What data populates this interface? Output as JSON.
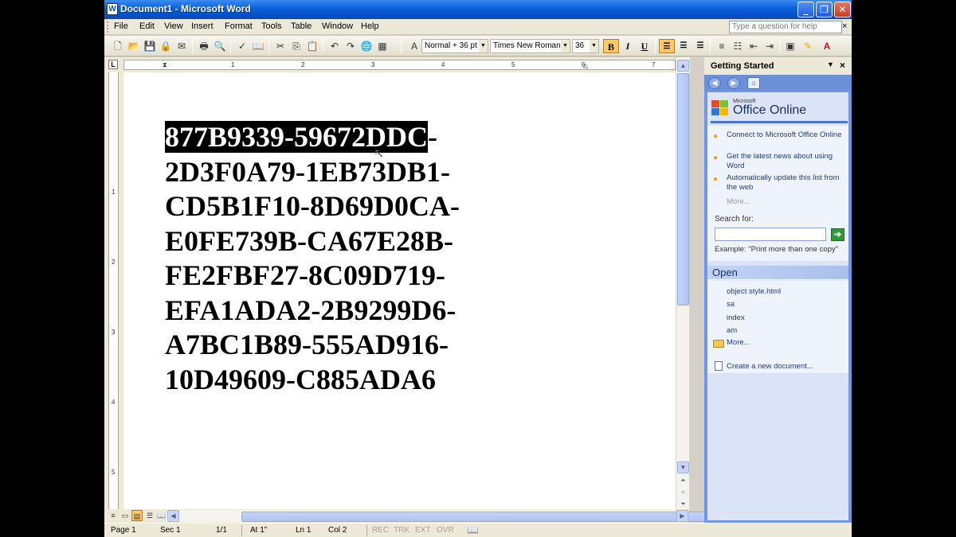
{
  "window": {
    "title": "Document1 - Microsoft Word",
    "app_icon_letter": "W"
  },
  "menubar": {
    "items": [
      "File",
      "Edit",
      "View",
      "Insert",
      "Format",
      "Tools",
      "Table",
      "Window",
      "Help"
    ],
    "help_placeholder": "Type a question for help",
    "close_glyph": "×"
  },
  "toolbar": {
    "style": "Normal + 36 pt",
    "font": "Times New Roman",
    "size": "36",
    "bold": "B",
    "italic": "I",
    "underline": "U"
  },
  "ruler": {
    "numbers": [
      "1",
      "2",
      "3",
      "4",
      "5",
      "6",
      "7"
    ],
    "vnumbers": [
      "1",
      "2",
      "3",
      "4",
      "5"
    ],
    "tab_glyph": "L"
  },
  "document": {
    "lines": [
      "877B9339-59672DDC",
      "2D3F0A79-1EB73DB1-",
      "CD5B1F10-8D69D0CA-",
      "E0FE739B-CA67E28B-",
      "FE2FBF27-8C09D719-",
      "EFA1ADA2-2B9299D6-",
      "A7BC1B89-555AD916-",
      "10D49609-C885ADA6"
    ],
    "first_line_trailing": "-"
  },
  "statusbar": {
    "page": "Page 1",
    "sec": "Sec 1",
    "pages": "1/1",
    "at": "At 1\"",
    "ln": "Ln 1",
    "col": "Col 2",
    "rec": "REC",
    "trk": "TRK",
    "ext": "EXT",
    "ovr": "OVR"
  },
  "taskpane": {
    "title": "Getting Started",
    "brand_small": "Microsoft",
    "brand": "Office Online",
    "links": [
      "Connect to Microsoft Office Online",
      "Get the latest news about using Word",
      "Automatically update this list from the web"
    ],
    "more": "More...",
    "search_label": "Search for:",
    "example": "Example:  \"Print more than one copy\"",
    "open_header": "Open",
    "recent_files": [
      "object style.html",
      "sa",
      "index",
      "am"
    ],
    "open_more": "More...",
    "create_new": "Create a new document..."
  }
}
